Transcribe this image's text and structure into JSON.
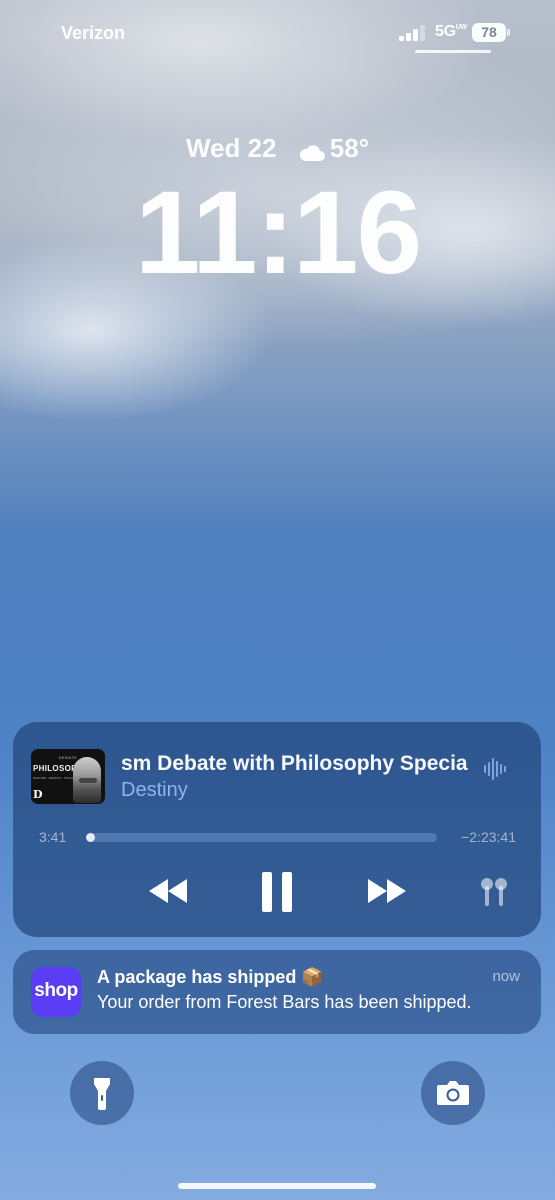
{
  "status_bar": {
    "carrier": "Verizon",
    "network": "5G",
    "network_suffix": "UW",
    "battery": "78"
  },
  "lock_screen": {
    "date": "Wed 22",
    "weather_icon": "cloud-icon",
    "temperature": "58°",
    "time": "11:16"
  },
  "now_playing": {
    "artwork": {
      "header": "DEBATE",
      "title": "PHILOSOPHY",
      "subtitle": "NIHILISM · DESTINY · PHILOSOPHY",
      "badge": "D"
    },
    "title": "sm Debate with Philosophy Specia",
    "artist": "Destiny",
    "elapsed": "3:41",
    "remaining": "−2:23:41",
    "progress": 0.026,
    "controls": [
      "rewind-icon",
      "pause-icon",
      "forward-icon",
      "airpods-icon"
    ]
  },
  "notification": {
    "app_icon_label": "shop",
    "title": "A package has shipped 📦",
    "time": "now",
    "body": "Your order from Forest Bars has been shipped."
  },
  "quick_actions": [
    "flashlight-icon",
    "camera-icon"
  ],
  "colors": {
    "shop_brand": "#5b3df5",
    "artist_text": "#8fb4ec",
    "card_background": "#23467d"
  }
}
